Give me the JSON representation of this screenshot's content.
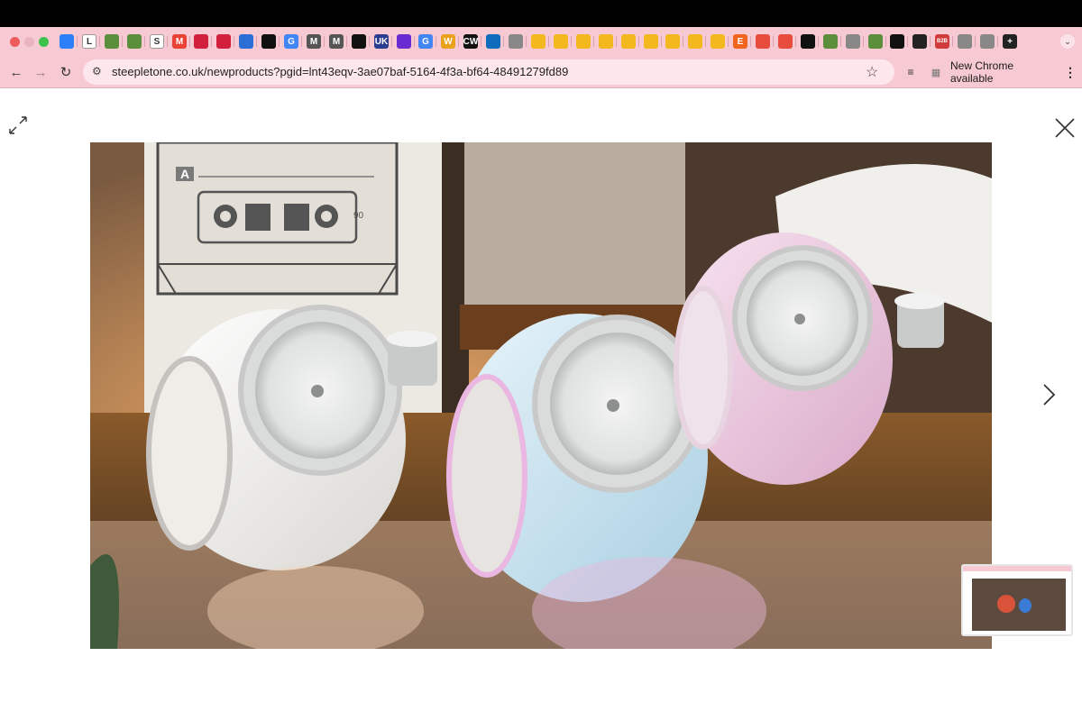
{
  "browser": {
    "tabs": [
      {
        "icon": "bookmark-check-icon",
        "letter": "",
        "color": "#2d7ff9"
      },
      {
        "icon": "letter-l-icon",
        "letter": "L",
        "color": "#ffffff"
      },
      {
        "icon": "shopify-icon",
        "letter": "",
        "color": "#5a8e3a"
      },
      {
        "icon": "shopify-icon",
        "letter": "",
        "color": "#5a8e3a"
      },
      {
        "icon": "letter-s-icon",
        "letter": "S",
        "color": "#ffffff"
      },
      {
        "icon": "gmail-icon",
        "letter": "M",
        "color": "#ea4335"
      },
      {
        "icon": "brand-icon",
        "letter": "",
        "color": "#d21f3c"
      },
      {
        "icon": "brand-icon",
        "letter": "",
        "color": "#d21f3c"
      },
      {
        "icon": "arrow-icon",
        "letter": "",
        "color": "#2b6fd6"
      },
      {
        "icon": "shopify-icon",
        "letter": "",
        "color": "#111111"
      },
      {
        "icon": "google-icon",
        "letter": "G",
        "color": "#4285f4"
      },
      {
        "icon": "letter-m-icon",
        "letter": "M",
        "color": "#555555"
      },
      {
        "icon": "letter-m-icon",
        "letter": "M",
        "color": "#555555"
      },
      {
        "icon": "tiktok-icon",
        "letter": "",
        "color": "#111111"
      },
      {
        "icon": "uk-icon",
        "letter": "UK",
        "color": "#2b3d8f"
      },
      {
        "icon": "target-icon",
        "letter": "",
        "color": "#6a2ad1"
      },
      {
        "icon": "google-icon",
        "letter": "G",
        "color": "#4285f4"
      },
      {
        "icon": "letter-w-icon",
        "letter": "W",
        "color": "#e8a21c"
      },
      {
        "icon": "cw-icon",
        "letter": "CW",
        "color": "#111111"
      },
      {
        "icon": "outlook-icon",
        "letter": "",
        "color": "#0f6cbd"
      },
      {
        "icon": "pdf-icon",
        "letter": "",
        "color": "#888888"
      },
      {
        "icon": "folder-icon",
        "letter": "",
        "color": "#f2b81d"
      },
      {
        "icon": "folder-icon",
        "letter": "",
        "color": "#f2b81d"
      },
      {
        "icon": "folder-icon",
        "letter": "",
        "color": "#f2b81d"
      },
      {
        "icon": "folder-icon",
        "letter": "",
        "color": "#f2b81d"
      },
      {
        "icon": "folder-icon",
        "letter": "",
        "color": "#f2b81d"
      },
      {
        "icon": "folder-icon",
        "letter": "",
        "color": "#f2b81d"
      },
      {
        "icon": "folder-icon",
        "letter": "",
        "color": "#f2b81d"
      },
      {
        "icon": "folder-icon",
        "letter": "",
        "color": "#f2b81d"
      },
      {
        "icon": "folder-icon",
        "letter": "",
        "color": "#f2b81d"
      },
      {
        "icon": "etsy-icon",
        "letter": "E",
        "color": "#f1641e"
      },
      {
        "icon": "google-red-icon",
        "letter": "",
        "color": "#e84c3d"
      },
      {
        "icon": "google-red-icon",
        "letter": "",
        "color": "#e84c3d"
      },
      {
        "icon": "shopify-icon",
        "letter": "",
        "color": "#111111"
      },
      {
        "icon": "shopify-icon",
        "letter": "",
        "color": "#5a8e3a"
      },
      {
        "icon": "pdf-icon",
        "letter": "",
        "color": "#888888"
      },
      {
        "icon": "shopify-icon",
        "letter": "",
        "color": "#5a8e3a"
      },
      {
        "icon": "x-logo-icon",
        "letter": "",
        "color": "#111111"
      },
      {
        "icon": "close-icon",
        "letter": "",
        "color": "#222222"
      },
      {
        "icon": "b2b-icon",
        "letter": "B2B",
        "color": "#d23b3b"
      },
      {
        "icon": "apple-icon",
        "letter": "",
        "color": "#888888"
      },
      {
        "icon": "apple-icon",
        "letter": "",
        "color": "#888888"
      },
      {
        "icon": "new-tab-icon",
        "letter": "+",
        "color": "#222222"
      }
    ],
    "url": "steepletone.co.uk/newproducts?pgid=lnt43eqv-3ae07baf-5164-4f3a-bf64-48491279fd89",
    "update_button": "New Chrome available",
    "accent": "#f6c9d3"
  },
  "viewer": {
    "cassette_label_letter": "A",
    "cassette_side_number": "90"
  }
}
